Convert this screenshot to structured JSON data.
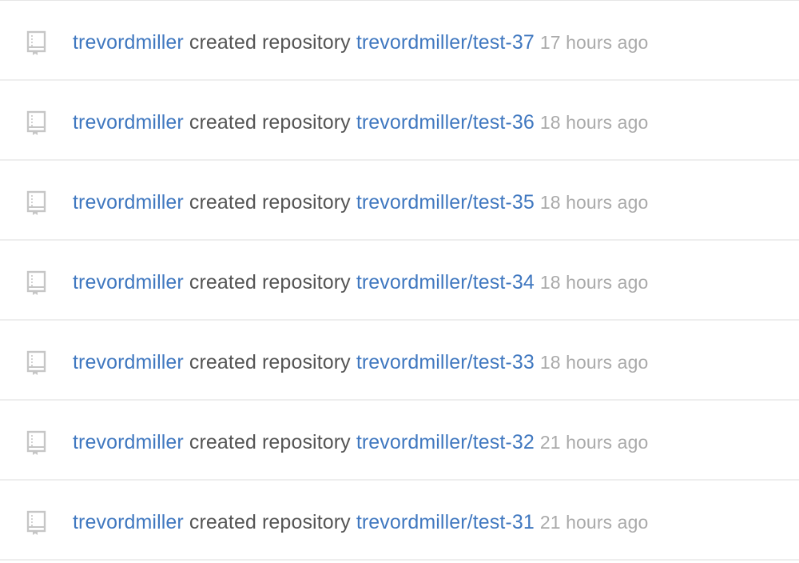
{
  "events": [
    {
      "actor": "trevordmiller",
      "action": "created repository",
      "repo": "trevordmiller/test-37",
      "time": "17 hours ago"
    },
    {
      "actor": "trevordmiller",
      "action": "created repository",
      "repo": "trevordmiller/test-36",
      "time": "18 hours ago"
    },
    {
      "actor": "trevordmiller",
      "action": "created repository",
      "repo": "trevordmiller/test-35",
      "time": "18 hours ago"
    },
    {
      "actor": "trevordmiller",
      "action": "created repository",
      "repo": "trevordmiller/test-34",
      "time": "18 hours ago"
    },
    {
      "actor": "trevordmiller",
      "action": "created repository",
      "repo": "trevordmiller/test-33",
      "time": "18 hours ago"
    },
    {
      "actor": "trevordmiller",
      "action": "created repository",
      "repo": "trevordmiller/test-32",
      "time": "21 hours ago"
    },
    {
      "actor": "trevordmiller",
      "action": "created repository",
      "repo": "trevordmiller/test-31",
      "time": "21 hours ago"
    }
  ],
  "icon": "repo-book-icon",
  "colors": {
    "link": "#4078c0",
    "text": "#555555",
    "muted": "#aaaaaa",
    "icon": "#c6c6c6",
    "divider": "#eeeeee"
  }
}
